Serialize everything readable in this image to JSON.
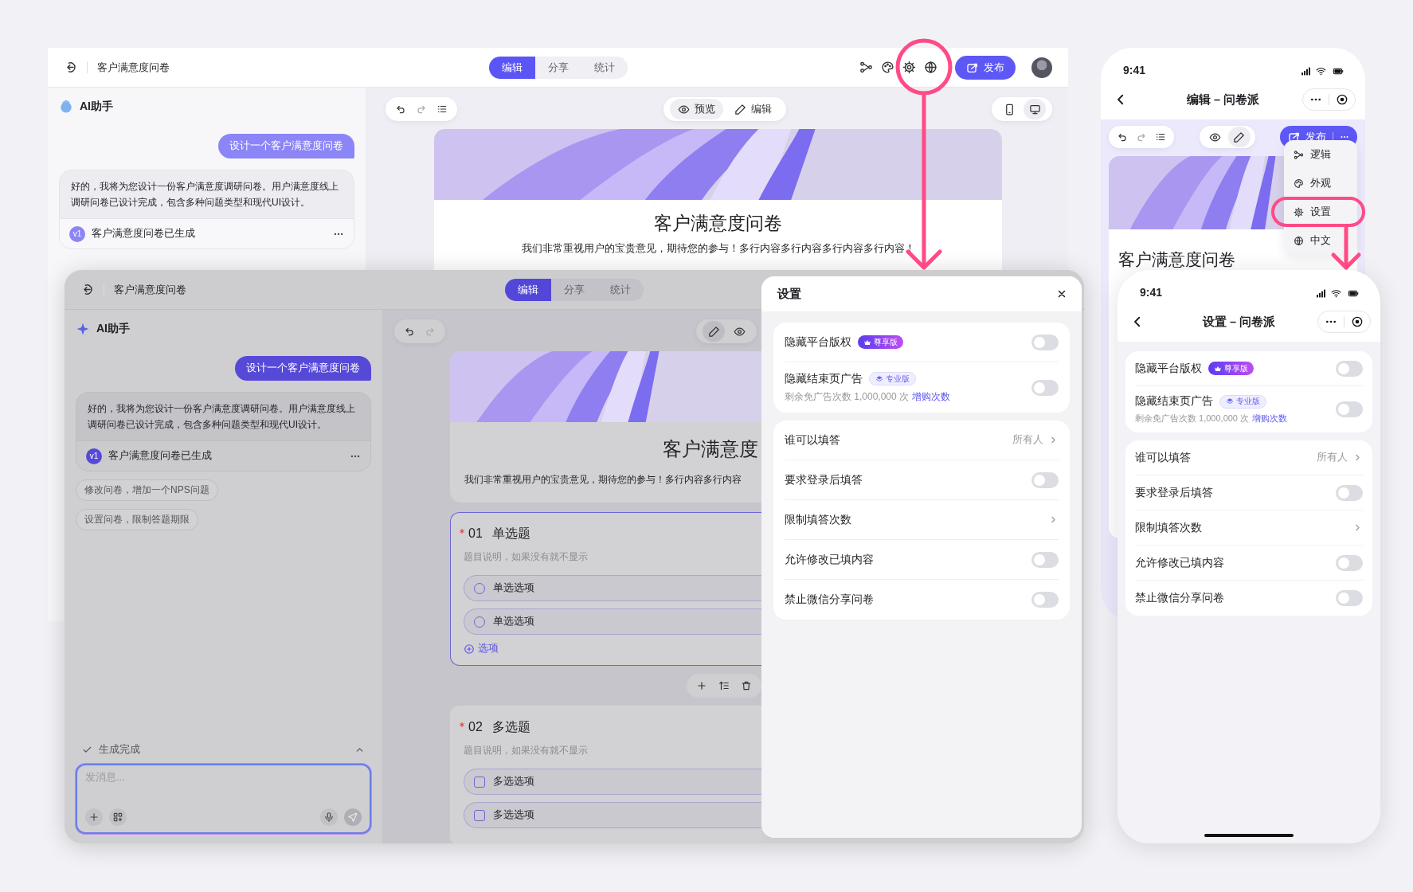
{
  "back_window": {
    "header": {
      "title": "客户满意度问卷",
      "tabs": [
        {
          "label": "编辑",
          "selected": true
        },
        {
          "label": "分享",
          "selected": false
        },
        {
          "label": "统计",
          "selected": false
        }
      ],
      "publish": "发布"
    },
    "assistant": {
      "title": "AI助手",
      "user_message": "设计一个客户满意度问卷",
      "reply": "好的，我将为您设计一份客户满意度调研问卷。用户满意度线上调研问卷已设计完成，包含多种问题类型和现代UI设计。",
      "artifact": {
        "version": "v1",
        "title": "客户满意度问卷已生成"
      }
    },
    "canvas": {
      "view_buttons": [
        {
          "kind": "preview",
          "label": "预览",
          "selected": true
        },
        {
          "kind": "edit",
          "label": "编辑",
          "selected": false
        }
      ],
      "devices": [
        {
          "kind": "phone",
          "selected": false
        },
        {
          "kind": "desktop",
          "selected": true
        }
      ],
      "title": "客户满意度问卷",
      "description": "我们非常重视用户的宝贵意见，期待您的参与！多行内容多行内容多行内容多行内容！"
    }
  },
  "front_window": {
    "header": {
      "title": "客户满意度问卷",
      "tabs": [
        {
          "label": "编辑",
          "selected": true
        },
        {
          "label": "分享",
          "selected": false
        },
        {
          "label": "统计",
          "selected": false
        }
      ]
    },
    "assistant": {
      "title": "AI助手",
      "user_message": "设计一个客户满意度问卷",
      "reply": "好的，我将为您设计一份客户满意度调研问卷。用户满意度线上调研问卷已设计完成，包含多种问题类型和现代UI设计。",
      "artifact": {
        "version": "v1",
        "title": "客户满意度问卷已生成"
      },
      "suggestions": [
        "修改问卷，增加一个NPS问题",
        "设置问卷，限制答题期限"
      ],
      "status": "生成完成",
      "input": {
        "placeholder": "发消息..."
      }
    },
    "canvas": {
      "view_buttons": [
        {
          "kind": "edit",
          "selected": true
        },
        {
          "kind": "preview",
          "selected": false
        }
      ],
      "title": "客户满意度",
      "description": "我们非常重视用户的宝贵意见，期待您的参与！多行内容多行内容",
      "questions": [
        {
          "number": "01",
          "title": "单选题",
          "hint": "题目说明，如果没有就不显示",
          "required": true,
          "selected": true,
          "options": [
            {
              "kind": "radio",
              "label": "单选选项"
            },
            {
              "kind": "radio",
              "label": "单选选项"
            }
          ],
          "add_option": "选项"
        },
        {
          "number": "02",
          "title": "多选题",
          "hint": "题目说明，如果没有就不显示",
          "required": true,
          "selected": false,
          "options": [
            {
              "kind": "checkbox",
              "label": "多选选项"
            },
            {
              "kind": "checkbox",
              "label": "多选选项"
            }
          ]
        }
      ]
    },
    "settings": {
      "title": "设置",
      "groups": [
        {
          "rows": [
            {
              "kind": "toggle",
              "label": "隐藏平台版权",
              "badge": {
                "kind": "premium",
                "text": "尊享版"
              },
              "on": false
            },
            {
              "kind": "toggle",
              "label": "隐藏结束页广告",
              "badge": {
                "kind": "pro",
                "text": "专业版"
              },
              "note": "剩余免广告次数 1,000,000 次",
              "link": "增购次数",
              "on": false
            }
          ]
        },
        {
          "rows": [
            {
              "kind": "link",
              "label": "谁可以填答",
              "value": "所有人"
            },
            {
              "kind": "toggle",
              "label": "要求登录后填答",
              "on": false
            },
            {
              "kind": "link",
              "label": "限制填答次数"
            },
            {
              "kind": "toggle",
              "label": "允许修改已填内容",
              "on": false
            },
            {
              "kind": "toggle",
              "label": "禁止微信分享问卷",
              "on": false
            }
          ]
        }
      ]
    }
  },
  "phone_back": {
    "time": "9:41",
    "nav_title": "编辑 – 问卷派",
    "view_buttons": [
      {
        "kind": "preview",
        "selected": false
      },
      {
        "kind": "edit",
        "selected": true
      }
    ],
    "publish": "发布",
    "menu": [
      {
        "kind": "logic",
        "label": "逻辑"
      },
      {
        "kind": "theme",
        "label": "外观"
      },
      {
        "kind": "settings",
        "label": "设置"
      },
      {
        "kind": "language",
        "label": "中文"
      }
    ],
    "title": "客户满意度问卷"
  },
  "phone_front": {
    "time": "9:41",
    "nav_title": "设置 – 问卷派",
    "groups": [
      {
        "rows": [
          {
            "kind": "toggle",
            "label": "隐藏平台版权",
            "badge": {
              "kind": "premium",
              "text": "尊享版"
            },
            "on": false
          },
          {
            "kind": "toggle",
            "label": "隐藏结束页广告",
            "badge": {
              "kind": "pro",
              "text": "专业版"
            },
            "note": "剩余免广告次数 1,000,000 次",
            "link": "增购次数",
            "on": false
          }
        ]
      },
      {
        "rows": [
          {
            "kind": "link",
            "label": "谁可以填答",
            "value": "所有人"
          },
          {
            "kind": "toggle",
            "label": "要求登录后填答",
            "on": false
          },
          {
            "kind": "link",
            "label": "限制填答次数"
          },
          {
            "kind": "toggle",
            "label": "允许修改已填内容",
            "on": false
          },
          {
            "kind": "toggle",
            "label": "禁止微信分享问卷",
            "on": false
          }
        ]
      }
    ]
  }
}
